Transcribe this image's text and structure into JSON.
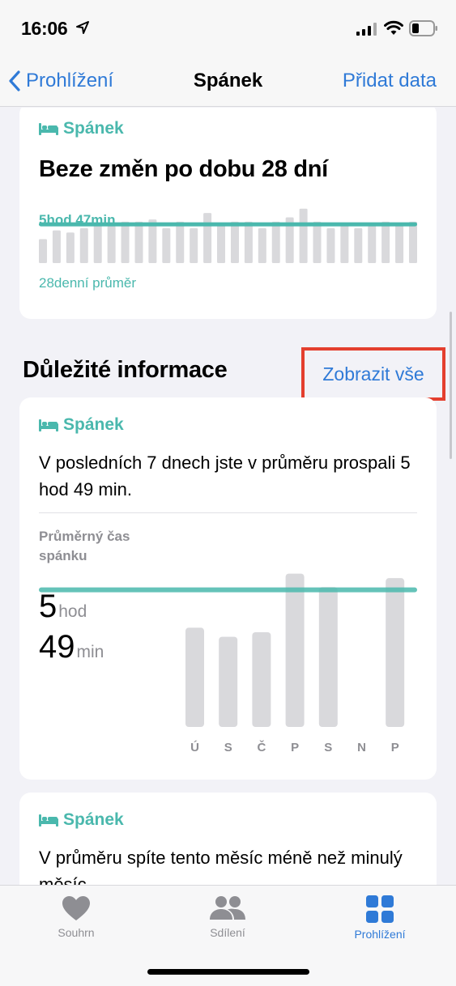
{
  "status_bar": {
    "time": "16:06"
  },
  "nav": {
    "back_label": "Prohlížení",
    "title": "Spánek",
    "add_label": "Přidat data"
  },
  "trend_card": {
    "category": "Spánek",
    "headline": "Beze změn po dobu 28 dní",
    "average_value": "5hod 47min",
    "average_caption": "28denní průměr"
  },
  "highlights": {
    "title": "Důležité informace",
    "show_all": "Zobrazit vše"
  },
  "weekly_card": {
    "category": "Spánek",
    "summary": "V posledních 7 dnech jste v průměru prospali 5 hod 49 min.",
    "avg_label": "Průměrný čas spánku",
    "hours_value": "5",
    "hours_unit": "hod",
    "minutes_value": "49",
    "minutes_unit": "min"
  },
  "monthly_card": {
    "category": "Spánek",
    "summary": "V průměru spíte tento měsíc méně než minulý měsíc."
  },
  "tabs": [
    {
      "label": "Souhrn",
      "icon": "heart-icon"
    },
    {
      "label": "Sdílení",
      "icon": "people-icon"
    },
    {
      "label": "Prohlížení",
      "icon": "grid-icon",
      "active": true
    }
  ],
  "colors": {
    "accent": "#2f7ad7",
    "sleep": "#4ab8ad",
    "bar": "#d9d9dc",
    "highlight_box": "#e43f2e"
  },
  "chart_data": [
    {
      "type": "bar",
      "series": [
        {
          "values": [
            5.1,
            5.5,
            5.4,
            5.6,
            5.8,
            5.7,
            5.9,
            5.9,
            6.0,
            5.6,
            5.9,
            5.6,
            6.3,
            5.8,
            5.9,
            5.9,
            5.6,
            5.9,
            6.1,
            6.5,
            5.9,
            5.6,
            5.8,
            5.6,
            5.7,
            5.9,
            5.8,
            5.9
          ]
        }
      ],
      "reference_line": 5.78
    },
    {
      "type": "bar",
      "categories": [
        "Ú",
        "S",
        "Č",
        "P",
        "S",
        "N",
        "P"
      ],
      "values": [
        5.4,
        5.3,
        5.35,
        6.0,
        5.85,
        0,
        5.95
      ],
      "reference_line": 5.82
    }
  ]
}
